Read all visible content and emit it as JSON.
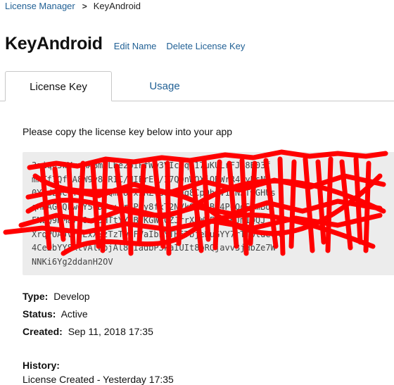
{
  "breadcrumb": {
    "root": "License Manager",
    "separator": ">",
    "current": "KeyAndroid"
  },
  "page": {
    "title": "KeyAndroid",
    "edit_name": "Edit Name",
    "delete_key": "Delete License Key"
  },
  "tabs": {
    "license_key": "License Key",
    "usage": "Usage",
    "active": "License Key"
  },
  "license": {
    "instruction": "Please copy the license key below into your app",
    "key_visible_fragments": "3ziqo5wVvnMABmWLbe2biFfWw3VIcoqR17uKULrFJo8B03f\nmhTf7Qf7A8W9v8uRIC/NIFrE4/I7QOnWQXjQBWrR4jyBsN\n0Y9dz4CcT8TtrgoQm/8vx5RZVB9E8qq8CpQhfV1gNJTwGHUs\nqHHAGiQkwdY5GDVc+zr7Ppy8fxT2NVk9v2hBx4PCQdS7mBd\nFNzQ9HMa7J0xm5HTtYYjBIKGWLCZJrrXDW6EQJxKJm1QQJ\nXrqPOAJV/gExXSzTzTwbFVaIbbYTH6TbjeKuGYY7rTT0ldeCR\n4Ce2bYY8ktVAlwpjAl8GIadbP3kaIUIt8pRQjavv3jHbZe7W\nNNKi6Yg2ddanH2OV",
    "redaction_color": "#ff0000"
  },
  "details": {
    "type_label": "Type:",
    "type_value": "Develop",
    "status_label": "Status:",
    "status_value": "Active",
    "created_label": "Created:",
    "created_value": "Sep 11, 2018 17:35"
  },
  "history": {
    "title": "History:",
    "items": [
      "License Created - Yesterday 17:35"
    ]
  },
  "colors": {
    "link": "#1f5f94",
    "key_background": "#ececec",
    "tab_border": "#c8c8c8"
  }
}
